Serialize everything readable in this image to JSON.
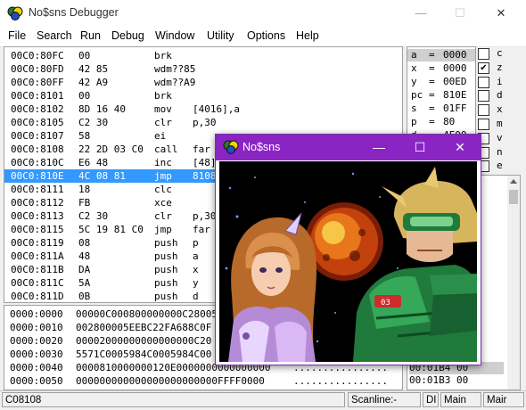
{
  "window": {
    "title": "No$sns Debugger",
    "minimize": "—",
    "maximize": "☐",
    "close": "✕"
  },
  "menu": [
    "File",
    "Search",
    "Run",
    "Debug",
    "Window",
    "Utility",
    "Options",
    "Help"
  ],
  "disassembly": [
    {
      "addr": "00C0:80FC",
      "bytes": "00",
      "op": "brk",
      "args": ""
    },
    {
      "addr": "00C0:80FD",
      "bytes": "42 85",
      "op": "wdm??85",
      "args": ""
    },
    {
      "addr": "00C0:80FF",
      "bytes": "42 A9",
      "op": "wdm??A9",
      "args": ""
    },
    {
      "addr": "00C0:8101",
      "bytes": "00",
      "op": "brk",
      "args": ""
    },
    {
      "addr": "00C0:8102",
      "bytes": "8D 16 40",
      "op": "mov",
      "args": "[4016],a"
    },
    {
      "addr": "00C0:8105",
      "bytes": "C2 30",
      "op": "clr",
      "args": "p,30"
    },
    {
      "addr": "00C0:8107",
      "bytes": "58",
      "op": "ei",
      "args": ""
    },
    {
      "addr": "00C0:8108",
      "bytes": "22 2D 03 C0",
      "op": "call",
      "args": "far C"
    },
    {
      "addr": "00C0:810C",
      "bytes": "E6 48",
      "op": "inc",
      "args": "[48]"
    },
    {
      "addr": "00C0:810E",
      "bytes": "4C 08 81",
      "op": "jmp",
      "args": "8108"
    },
    {
      "addr": "00C0:8111",
      "bytes": "18",
      "op": "clc",
      "args": ""
    },
    {
      "addr": "00C0:8112",
      "bytes": "FB",
      "op": "xce",
      "args": ""
    },
    {
      "addr": "00C0:8113",
      "bytes": "C2 30",
      "op": "clr",
      "args": "p,30"
    },
    {
      "addr": "00C0:8115",
      "bytes": "5C 19 81 C0",
      "op": "jmp",
      "args": "far C"
    },
    {
      "addr": "00C0:8119",
      "bytes": "08",
      "op": "push",
      "args": "p"
    },
    {
      "addr": "00C0:811A",
      "bytes": "48",
      "op": "push",
      "args": "a"
    },
    {
      "addr": "00C0:811B",
      "bytes": "DA",
      "op": "push",
      "args": "x"
    },
    {
      "addr": "00C0:811C",
      "bytes": "5A",
      "op": "push",
      "args": "y"
    },
    {
      "addr": "00C0:811D",
      "bytes": "0B",
      "op": "push",
      "args": "d"
    }
  ],
  "selected_row": 9,
  "registers": [
    {
      "name": "a",
      "value": "0000"
    },
    {
      "name": "x",
      "value": "0000"
    },
    {
      "name": "y",
      "value": "00ED"
    },
    {
      "name": "pc",
      "value": "810E"
    },
    {
      "name": "s",
      "value": "01FF"
    },
    {
      "name": "p",
      "value": "80"
    },
    {
      "name": "d",
      "value": "4F00"
    }
  ],
  "flags": [
    {
      "name": "c",
      "checked": false
    },
    {
      "name": "z",
      "checked": true
    },
    {
      "name": "i",
      "checked": false
    },
    {
      "name": "d",
      "checked": false
    },
    {
      "name": "x",
      "checked": false
    },
    {
      "name": "m",
      "checked": false
    },
    {
      "name": "v",
      "checked": false
    },
    {
      "name": "n",
      "checked": false
    },
    {
      "name": "e",
      "checked": false
    }
  ],
  "stack": {
    "row1": "00:01B4 00",
    "row2": "00:01B3 00"
  },
  "memory": [
    {
      "addr": "0000:0000",
      "hex": "00000C000800000000C28005",
      "ascii": ""
    },
    {
      "addr": "0000:0010",
      "hex": "002800005EEBC22FA688C0F",
      "ascii": ""
    },
    {
      "addr": "0000:0020",
      "hex": "00002000000000000000C20",
      "ascii": ""
    },
    {
      "addr": "0000:0030",
      "hex": "5571C0005984C0005984C00",
      "ascii": ""
    },
    {
      "addr": "0000:0040",
      "hex": "0000810000000120E0000000000000000",
      "ascii": "................"
    },
    {
      "addr": "0000:0050",
      "hex": "000000000000000000000000FFFF0000",
      "ascii": "................"
    }
  ],
  "status": {
    "pos": "C08108",
    "scanline": "Scanline:-",
    "di": "DI",
    "main": "Main",
    "main2": "Mair"
  },
  "emulator": {
    "title": "No$sns",
    "minimize": "—",
    "maximize": "☐",
    "close": "✕"
  },
  "colors": {
    "emu_titlebar": "#8a25c4",
    "selection": "#3399ff"
  }
}
